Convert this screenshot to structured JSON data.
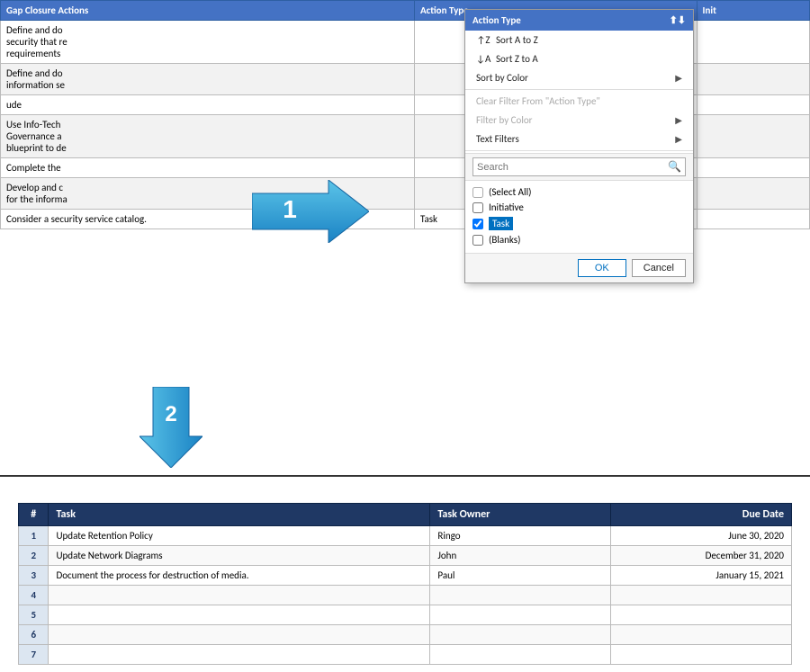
{
  "spreadsheet": {
    "header": {
      "gap_closure": "Gap Closure Actions",
      "action_type": "Action Type",
      "init": "Init"
    },
    "rows": [
      {
        "gap": "Define and do security that re requirements",
        "action": "",
        "init": ""
      },
      {
        "gap": "Define and do information se",
        "action": "",
        "init": ""
      },
      {
        "gap": "ude",
        "action": "",
        "init": ""
      },
      {
        "gap": "Use Info-Tech Governance a blueprint to de",
        "action": "",
        "init": ""
      },
      {
        "gap": "Complete the",
        "action": "",
        "init": ""
      },
      {
        "gap": "Develop and c for the informa",
        "action": "",
        "init": ""
      },
      {
        "gap": "Consider a security service catalog.",
        "action": "Task",
        "init": ""
      }
    ]
  },
  "dropdown": {
    "title": "Action Type",
    "sort_az": "Sort A to Z",
    "sort_za": "Sort Z to A",
    "sort_by_color": "Sort by Color",
    "clear_filter": "Clear Filter From \"Action Type\"",
    "filter_by_color": "Filter by Color",
    "text_filters": "Text Filters",
    "search_placeholder": "Search",
    "checkboxes": [
      {
        "label": "(Select All)",
        "checked": "partial",
        "highlighted": false
      },
      {
        "label": "Initiative",
        "checked": false,
        "highlighted": false
      },
      {
        "label": "Task",
        "checked": true,
        "highlighted": true
      },
      {
        "label": "(Blanks)",
        "checked": false,
        "highlighted": false
      }
    ],
    "ok_label": "OK",
    "cancel_label": "Cancel"
  },
  "arrows": [
    {
      "id": "arrow-1",
      "direction": "right",
      "number": "1"
    },
    {
      "id": "arrow-2",
      "direction": "down",
      "number": "2"
    }
  ],
  "bottom_table": {
    "headers": {
      "num": "#",
      "task": "Task",
      "owner": "Task Owner",
      "due_date": "Due Date"
    },
    "rows": [
      {
        "num": "1",
        "task": "Update Retention Policy",
        "owner": "Ringo",
        "due_date": "June 30, 2020"
      },
      {
        "num": "2",
        "task": "Update Network Diagrams",
        "owner": "John",
        "due_date": "December 31, 2020"
      },
      {
        "num": "3",
        "task": "Document the process for destruction of media.",
        "owner": "Paul",
        "due_date": "January 15, 2021"
      },
      {
        "num": "4",
        "task": "",
        "owner": "",
        "due_date": ""
      },
      {
        "num": "5",
        "task": "",
        "owner": "",
        "due_date": ""
      },
      {
        "num": "6",
        "task": "",
        "owner": "",
        "due_date": ""
      },
      {
        "num": "7",
        "task": "",
        "owner": "",
        "due_date": ""
      }
    ]
  }
}
